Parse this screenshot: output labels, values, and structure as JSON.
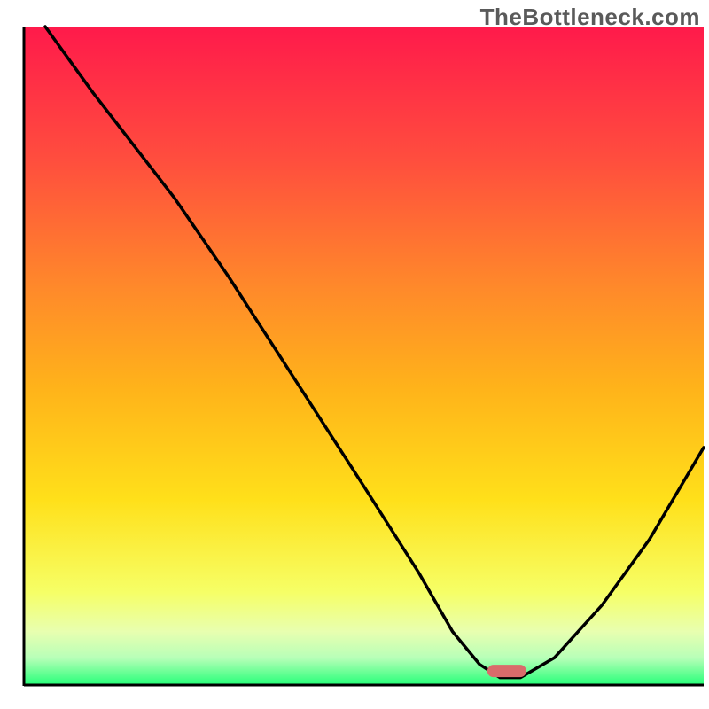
{
  "watermark": "TheBottleneck.com",
  "chart_data": {
    "type": "line",
    "title": "",
    "xlabel": "",
    "ylabel": "",
    "xlim": [
      0,
      100
    ],
    "ylim": [
      0,
      100
    ],
    "x": [
      3,
      10,
      22,
      30,
      40,
      50,
      58,
      63,
      67,
      70,
      73,
      78,
      85,
      92,
      100
    ],
    "values": [
      100,
      90,
      74,
      62,
      46,
      30,
      17,
      8,
      3,
      1,
      1,
      4,
      12,
      22,
      36
    ],
    "marker": {
      "x": 71,
      "y": 2,
      "color": "#d96b6b"
    },
    "background_gradient": [
      {
        "stop": 0.0,
        "color": "#ff1a4b"
      },
      {
        "stop": 0.2,
        "color": "#ff4d3e"
      },
      {
        "stop": 0.4,
        "color": "#ff8a2a"
      },
      {
        "stop": 0.55,
        "color": "#ffb31a"
      },
      {
        "stop": 0.72,
        "color": "#ffe01a"
      },
      {
        "stop": 0.86,
        "color": "#f6ff66"
      },
      {
        "stop": 0.92,
        "color": "#e8ffb0"
      },
      {
        "stop": 0.96,
        "color": "#b8ffb8"
      },
      {
        "stop": 1.0,
        "color": "#2aff7a"
      }
    ]
  }
}
